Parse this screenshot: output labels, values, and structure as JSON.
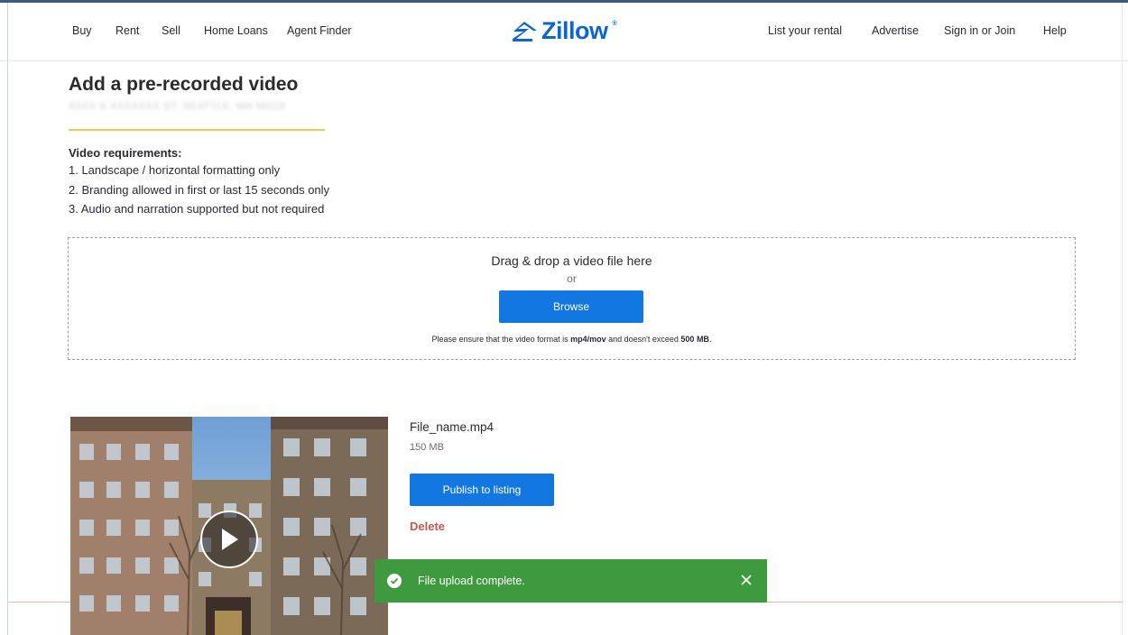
{
  "nav": {
    "left": [
      {
        "label": "Buy"
      },
      {
        "label": "Rent"
      },
      {
        "label": "Sell"
      },
      {
        "label": "Home Loans"
      },
      {
        "label": "Agent Finder"
      }
    ],
    "right": [
      {
        "label": "List your rental"
      },
      {
        "label": "Advertise"
      },
      {
        "label": "Sign in or Join"
      },
      {
        "label": "Help"
      }
    ],
    "brand": "Zillow",
    "trademark": "®"
  },
  "page": {
    "title": "Add a pre-recorded video",
    "address": "4XXX S XXXXXXX ST, SEATTLE, WA 98118"
  },
  "requirements": {
    "heading": "Video requirements:",
    "items": [
      "1.  Landscape / horizontal formatting only",
      "2. Branding allowed in first or last 15 seconds only",
      "3.  Audio and narration supported but not required"
    ]
  },
  "dropzone": {
    "text": "Drag & drop a video file here",
    "or": "or",
    "browse_label": "Browse",
    "note_prefix": "Please ensure that the video format is ",
    "note_format": "mp4/mov",
    "note_middle": " and doesn't exceed ",
    "note_limit": "500 MB",
    "note_suffix": "."
  },
  "file": {
    "name": "File_name.mp4",
    "size": "150 MB",
    "publish_label": "Publish to listing",
    "delete_label": "Delete"
  },
  "toast": {
    "message": "File upload complete."
  },
  "colors": {
    "primary": "#1277e1",
    "brand": "#0d66d0",
    "success": "#3f9a3f",
    "danger": "#c0594f",
    "accent_rule": "#f4c546"
  }
}
